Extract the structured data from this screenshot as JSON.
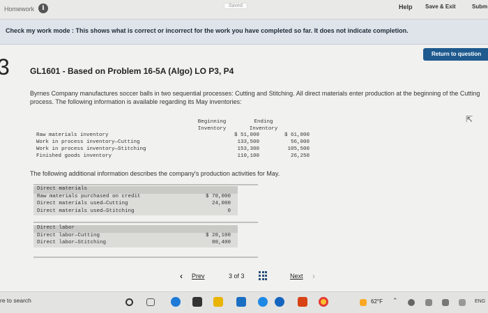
{
  "topbar": {
    "homework": "Homework",
    "saved": "Saved",
    "help": "Help",
    "save_exit": "Save & Exit",
    "submit": "Subm"
  },
  "banner": {
    "message": "Check my work mode : This shows what is correct or incorrect for the work you have completed so far. It does not indicate completion."
  },
  "return_button": "Return to question",
  "question_number": "3",
  "title": "GL1601 - Based on Problem 16-5A (Algo) LO P3, P4",
  "paragraph1": "Byrnes Company manufactures soccer balls in two sequential processes: Cutting and Stitching. All direct materials enter production at the beginning of the Cutting process. The following information is available regarding its May inventories:",
  "inventory": {
    "col_beginning": "Beginning Inventory",
    "col_ending": "Ending Inventory",
    "rows": [
      {
        "label": "Raw materials inventory",
        "beginning": "$ 51,000",
        "ending": "$ 61,000"
      },
      {
        "label": "Work in process inventory—Cutting",
        "beginning": "133,500",
        "ending": "56,000"
      },
      {
        "label": "Work in process inventory—Stitching",
        "beginning": "153,300",
        "ending": "105,500"
      },
      {
        "label": "Finished goods inventory",
        "beginning": "110,100",
        "ending": "26,250"
      }
    ]
  },
  "paragraph2": "The following additional information describes the company's production activities for May.",
  "direct_materials": {
    "heading": "Direct materials",
    "rows": [
      {
        "label": "Raw materials purchased on credit",
        "value": "$ 70,000"
      },
      {
        "label": "Direct materials used—Cutting",
        "value": "24,000"
      },
      {
        "label": "Direct materials used—Stitching",
        "value": "0"
      }
    ]
  },
  "direct_labor": {
    "heading": "Direct labor",
    "rows": [
      {
        "label": "Direct labor—Cutting",
        "value": "$ 20,100"
      },
      {
        "label": "Direct labor—Stitching",
        "value": "80,400"
      }
    ]
  },
  "pager": {
    "prev": "Prev",
    "current": "3",
    "total": "3",
    "of_text": "3 of 3",
    "next": "Next"
  },
  "taskbar": {
    "search": "re to search",
    "temperature": "62°F",
    "language": "ENG"
  },
  "colors": {
    "banner_bg": "#dfe4ea",
    "return_button": "#1e5a8e"
  }
}
